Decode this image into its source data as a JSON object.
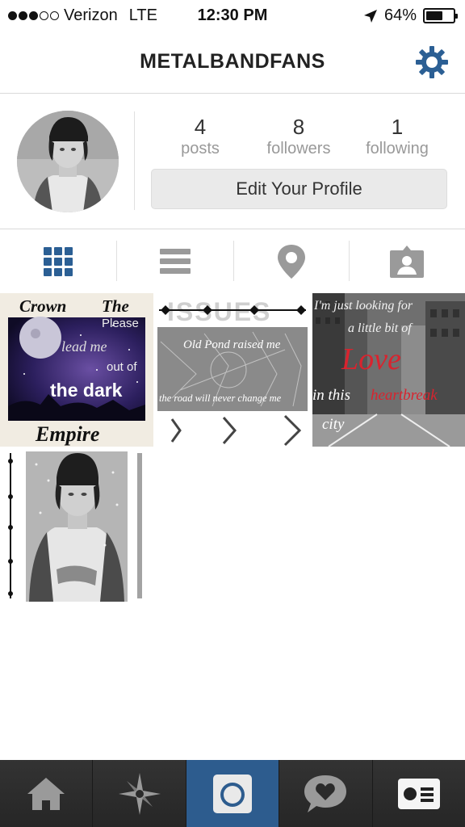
{
  "status_bar": {
    "carrier": "Verizon",
    "network": "LTE",
    "time": "12:30 PM",
    "battery": "64%",
    "battery_level": 0.64,
    "signal_bars": 3,
    "signal_total": 5
  },
  "header": {
    "username": "METALBANDFANS",
    "settings_icon": "gear-icon"
  },
  "profile": {
    "stats": [
      {
        "value": "4",
        "label": "posts"
      },
      {
        "value": "8",
        "label": "followers"
      },
      {
        "value": "1",
        "label": "following"
      }
    ],
    "edit_button": "Edit Your Profile"
  },
  "view_tabs": [
    {
      "name": "grid-view",
      "icon": "grid-icon",
      "active": true
    },
    {
      "name": "list-view",
      "icon": "list-icon",
      "active": false
    },
    {
      "name": "map-view",
      "icon": "location-pin-icon",
      "active": false
    },
    {
      "name": "tagged-view",
      "icon": "tagged-person-icon",
      "active": false
    }
  ],
  "posts": [
    {
      "texts": {
        "a": "Crown",
        "b": "The",
        "c": "Please",
        "d": "lead me",
        "e": "out of",
        "f": "the dark",
        "g": "Empire"
      }
    },
    {
      "texts": {
        "a": "ISSUES",
        "b": "Old Pond raised me",
        "c": "the road will never change me"
      }
    },
    {
      "texts": {
        "a": "I'm just looking for",
        "b": "a little bit of",
        "c": "Love",
        "d": "in this",
        "e": "heartbreak",
        "f": "city"
      }
    },
    {
      "texts": {}
    }
  ],
  "bottom_nav": [
    {
      "name": "home",
      "icon": "home-icon",
      "active": false
    },
    {
      "name": "explore",
      "icon": "explore-star-icon",
      "active": false
    },
    {
      "name": "camera",
      "icon": "camera-icon",
      "active": true
    },
    {
      "name": "activity",
      "icon": "heart-bubble-icon",
      "active": false
    },
    {
      "name": "profile",
      "icon": "profile-card-icon",
      "active": false
    }
  ],
  "colors": {
    "accent": "#2d5c8e",
    "active_tab_icon": "#2b5f94",
    "inactive_icon": "#999999",
    "nav_background": "#2b2b2b"
  }
}
